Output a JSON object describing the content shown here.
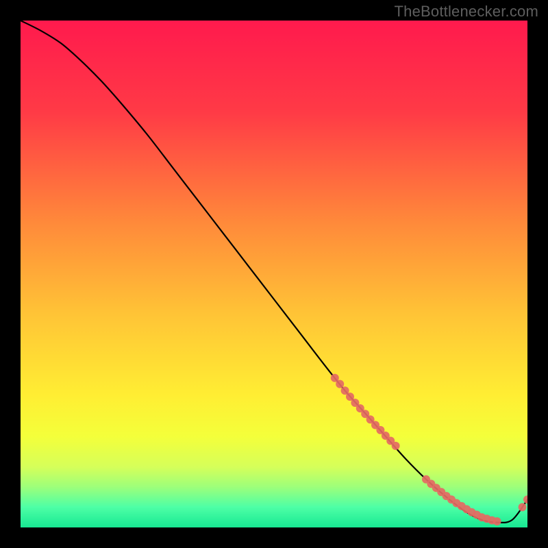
{
  "watermark": "TheBottlenecker.com",
  "gradient_stops": [
    {
      "pct": 0,
      "color": "#ff1a4d"
    },
    {
      "pct": 18,
      "color": "#ff3a46"
    },
    {
      "pct": 40,
      "color": "#ff8a3a"
    },
    {
      "pct": 58,
      "color": "#ffc436"
    },
    {
      "pct": 74,
      "color": "#ffee33"
    },
    {
      "pct": 82,
      "color": "#f4ff3a"
    },
    {
      "pct": 88,
      "color": "#d6ff59"
    },
    {
      "pct": 92,
      "color": "#9dff7a"
    },
    {
      "pct": 96,
      "color": "#4dffa6"
    },
    {
      "pct": 100,
      "color": "#17e892"
    }
  ],
  "chart_data": {
    "type": "line",
    "title": "",
    "xlabel": "",
    "ylabel": "",
    "xlim": [
      0,
      100
    ],
    "ylim": [
      0,
      100
    ],
    "legend": false,
    "grid": false,
    "series": [
      {
        "name": "bottleneck-curve",
        "x": [
          0,
          4,
          8,
          12,
          16,
          20,
          25,
          30,
          35,
          40,
          45,
          50,
          55,
          60,
          64,
          68,
          72,
          76,
          80,
          84,
          88,
          91,
          94,
          97,
          100
        ],
        "y": [
          100,
          98,
          95.5,
          92,
          88,
          83.5,
          77.5,
          71,
          64.5,
          58,
          51.5,
          45,
          38.5,
          32,
          27,
          22.5,
          18,
          13.5,
          9.5,
          6,
          3,
          1.5,
          1,
          1.5,
          5.5
        ],
        "color": "#000000"
      }
    ],
    "clusters": [
      {
        "name": "cluster-upper",
        "color": "#e46a63",
        "radius": 6,
        "x": [
          62,
          63,
          64,
          65,
          66,
          67,
          68,
          69,
          70,
          71,
          72,
          73,
          74
        ],
        "y": [
          29.5,
          28.3,
          27.0,
          25.8,
          24.6,
          23.5,
          22.4,
          21.3,
          20.2,
          19.2,
          18.1,
          17.1,
          16.1
        ]
      },
      {
        "name": "cluster-lower-band",
        "color": "#e46a63",
        "radius": 6,
        "x": [
          80,
          81,
          82,
          83,
          84,
          85,
          86,
          87,
          88,
          89,
          90,
          91,
          92,
          93,
          94
        ],
        "y": [
          9.5,
          8.6,
          7.8,
          7.0,
          6.2,
          5.5,
          4.8,
          4.2,
          3.6,
          3.0,
          2.5,
          2.0,
          1.7,
          1.4,
          1.2
        ]
      },
      {
        "name": "cluster-tail-right",
        "color": "#e46a63",
        "radius": 6,
        "x": [
          99,
          100
        ],
        "y": [
          4.0,
          5.5
        ]
      }
    ]
  }
}
